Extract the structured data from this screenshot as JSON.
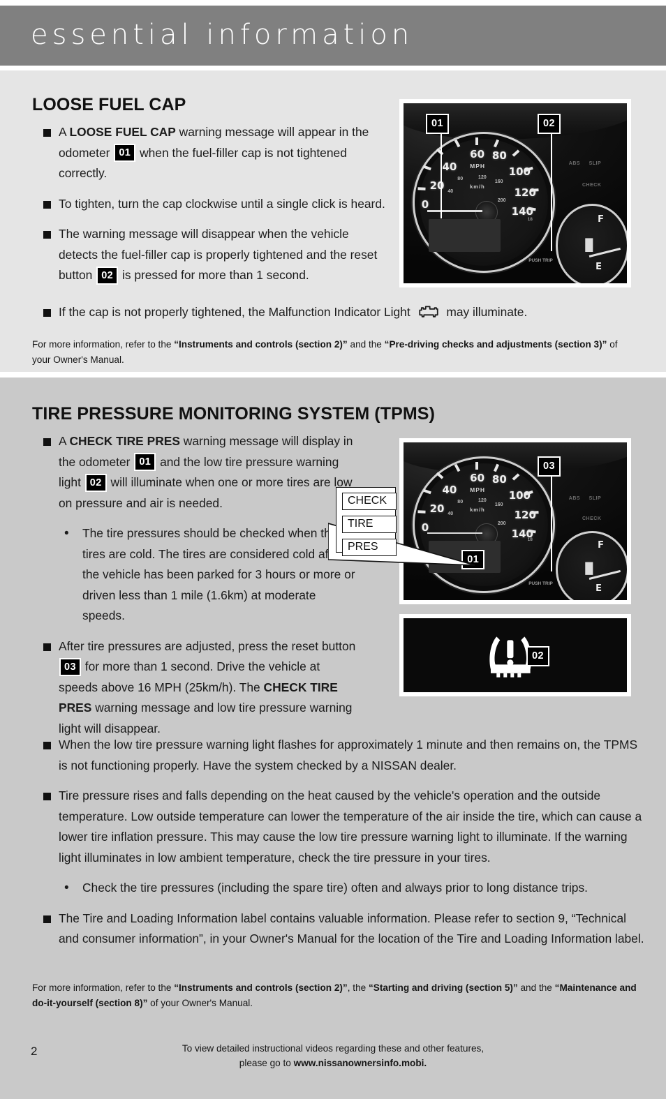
{
  "header": {
    "title": "essential information",
    "bar_color": "#808080"
  },
  "colors": {
    "section_one_bg": "#e5e5e5",
    "section_two_bg": "#c9c9c9",
    "badge_bg": "#000000",
    "badge_text": "#ffffff",
    "page_bg": "#ffffff"
  },
  "section_one": {
    "heading": "LOOSE FUEL CAP",
    "bullets": [
      {
        "parts": [
          {
            "t": "text",
            "v": "A "
          },
          {
            "t": "bold",
            "v": "LOOSE FUEL CAP"
          },
          {
            "t": "text",
            "v": " warning message will appear in the odometer "
          },
          {
            "t": "badge",
            "v": "01"
          },
          {
            "t": "text",
            "v": " when the fuel-filler cap is not tightened correctly."
          }
        ]
      },
      {
        "parts": [
          {
            "t": "text",
            "v": "To tighten, turn the cap clockwise until a single click is heard."
          }
        ]
      },
      {
        "parts": [
          {
            "t": "text",
            "v": "The warning message will disappear when the vehicle detects the fuel-filler cap is properly tightened and the reset button "
          },
          {
            "t": "badge",
            "v": "02"
          },
          {
            "t": "text",
            "v": " is pressed for more than 1 second."
          }
        ]
      }
    ],
    "wide_bullet": {
      "parts": [
        {
          "t": "text",
          "v": "If the cap is not properly tightened, the Malfunction Indicator Light "
        },
        {
          "t": "icon",
          "v": "malfunction-indicator-light-icon"
        },
        {
          "t": "text",
          "v": " may illuminate."
        }
      ]
    },
    "footnote": [
      {
        "t": "text",
        "v": "For more information, refer to the "
      },
      {
        "t": "bold",
        "v": "“Instruments and controls (section 2)”"
      },
      {
        "t": "text",
        "v": " and the "
      },
      {
        "t": "bold",
        "v": "“Pre-driving checks and adjustments (section 3)”"
      },
      {
        "t": "text",
        "v": " of your Owner's Manual."
      }
    ],
    "photo": {
      "name": "instrument-cluster-photo",
      "badges": [
        "01",
        "02"
      ],
      "speedometer": {
        "unit_primary": "MPH",
        "unit_secondary": "km/h",
        "mph_labels": [
          "0",
          "20",
          "40",
          "60",
          "80",
          "100",
          "120",
          "140"
        ],
        "kmh_labels": [
          "40",
          "80",
          "120",
          "160",
          "200"
        ],
        "trip_marks": [
          "18"
        ],
        "push_label": "PUSH TRIP"
      },
      "fuel_gauge": {
        "full": "F",
        "empty": "E"
      },
      "telltales": [
        "ABS",
        "SLIP",
        "CHECK"
      ]
    }
  },
  "section_two": {
    "heading": "TIRE PRESSURE MONITORING SYSTEM (TPMS)",
    "bullets": [
      {
        "indent": "bullet",
        "parts": [
          {
            "t": "text",
            "v": "A "
          },
          {
            "t": "bold",
            "v": "CHECK TIRE PRES"
          },
          {
            "t": "text",
            "v": " warning message will display in the odometer "
          },
          {
            "t": "badge",
            "v": "01"
          },
          {
            "t": "text",
            "v": " and the low tire pressure warning light "
          },
          {
            "t": "badge",
            "v": "02"
          },
          {
            "t": "text",
            "v": " will illuminate when one or more tires are low on pressure and air is needed."
          }
        ]
      },
      {
        "indent": "sub",
        "parts": [
          {
            "t": "text",
            "v": "The tire pressures should be checked when the tires are cold. The tires are considered cold after the vehicle has been parked for 3 hours or more or driven less than 1 mile (1.6km) at moderate speeds."
          }
        ]
      },
      {
        "indent": "bullet",
        "parts": [
          {
            "t": "text",
            "v": "After tire pressures are adjusted, press the reset button "
          },
          {
            "t": "badge",
            "v": "03"
          },
          {
            "t": "text",
            "v": " for more than 1 second. Drive the vehicle at speeds above 16 MPH (25km/h). The "
          },
          {
            "t": "bold",
            "v": "CHECK TIRE PRES"
          },
          {
            "t": "text",
            "v": " warning message and low tire pressure warning light will disappear."
          }
        ]
      }
    ],
    "wide_bullets": [
      {
        "indent": "bullet",
        "parts": [
          {
            "t": "text",
            "v": "When the low tire pressure warning light flashes for approximately 1 minute and then remains on, the TPMS is not functioning properly. Have the system checked by a NISSAN dealer."
          }
        ]
      },
      {
        "indent": "bullet",
        "parts": [
          {
            "t": "text",
            "v": "Tire pressure rises and falls depending on the heat caused by the vehicle's operation and the outside temperature. Low outside temperature can lower the temperature of the air inside the tire, which can cause a lower tire inflation pressure. This may cause the low tire pressure warning light to illuminate. If the warning light illuminates in low ambient temperature, check the tire pressure in your tires."
          }
        ]
      },
      {
        "indent": "sub",
        "parts": [
          {
            "t": "text",
            "v": "Check the tire pressures (including the spare tire) often and always prior to long distance trips."
          }
        ]
      },
      {
        "indent": "bullet",
        "parts": [
          {
            "t": "text",
            "v": "The Tire and Loading Information label contains valuable information. Please refer to section 9, “Technical and consumer information”, in your Owner's Manual for the location of the Tire and Loading Information label."
          }
        ]
      }
    ],
    "callout": {
      "name": "check-tire-pres-callout",
      "items": [
        "CHECK",
        "TIRE",
        "PRES"
      ]
    },
    "footnote": [
      {
        "t": "text",
        "v": "For more information, refer to the "
      },
      {
        "t": "bold",
        "v": "“Instruments and controls (section 2)”"
      },
      {
        "t": "text",
        "v": ", the "
      },
      {
        "t": "bold",
        "v": "“Starting and driving (section 5)”"
      },
      {
        "t": "text",
        "v": " and the "
      },
      {
        "t": "bold",
        "v": "“Maintenance and do-it-yourself (section 8)”"
      },
      {
        "t": "text",
        "v": " of your Owner's Manual."
      }
    ],
    "photo_cluster": {
      "name": "instrument-cluster-photo-tpms",
      "badges": [
        "03",
        "01"
      ]
    },
    "photo_lamp": {
      "name": "low-tire-pressure-warning-light-photo",
      "icon": "tpms-warning-light-icon",
      "badges": [
        "02"
      ]
    }
  },
  "footer": {
    "page_number": "2",
    "line1": "To view detailed instructional videos regarding these and other features,",
    "line2_prefix": "please go to ",
    "line2_url": "www.nissanownersinfo.mobi."
  }
}
